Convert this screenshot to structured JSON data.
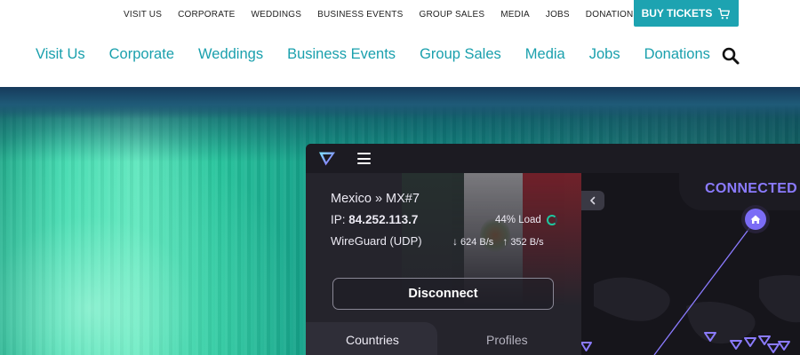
{
  "top_nav": {
    "items": [
      "VISIT US",
      "CORPORATE",
      "WEDDINGS",
      "BUSINESS EVENTS",
      "GROUP SALES",
      "MEDIA",
      "JOBS",
      "DONATIONS"
    ],
    "buy_label": "BUY TICKETS"
  },
  "main_nav": {
    "items": [
      "Visit Us",
      "Corporate",
      "Weddings",
      "Business Events",
      "Group Sales",
      "Media",
      "Jobs",
      "Donations"
    ]
  },
  "colors": {
    "accent": "#1aa0ad",
    "buy_button": "#1da3b1",
    "vpn_bg": "#1c1b22",
    "vpn_purple": "#8b7bff",
    "load_ring": "#1ec8a0"
  },
  "vpn": {
    "server": "Mexico » MX#7",
    "ip_label": "IP:",
    "ip_value": "84.252.113.7",
    "load": "44% Load",
    "protocol": "WireGuard (UDP)",
    "download": "624 B/s",
    "upload": "352 B/s",
    "disconnect_label": "Disconnect",
    "tabs": [
      "Countries",
      "Profiles"
    ],
    "status": "CONNECTED",
    "icons": [
      "proton-vpn-logo-icon",
      "hamburger-menu-icon",
      "chevron-left-icon",
      "home-icon",
      "server-marker-icon"
    ]
  }
}
